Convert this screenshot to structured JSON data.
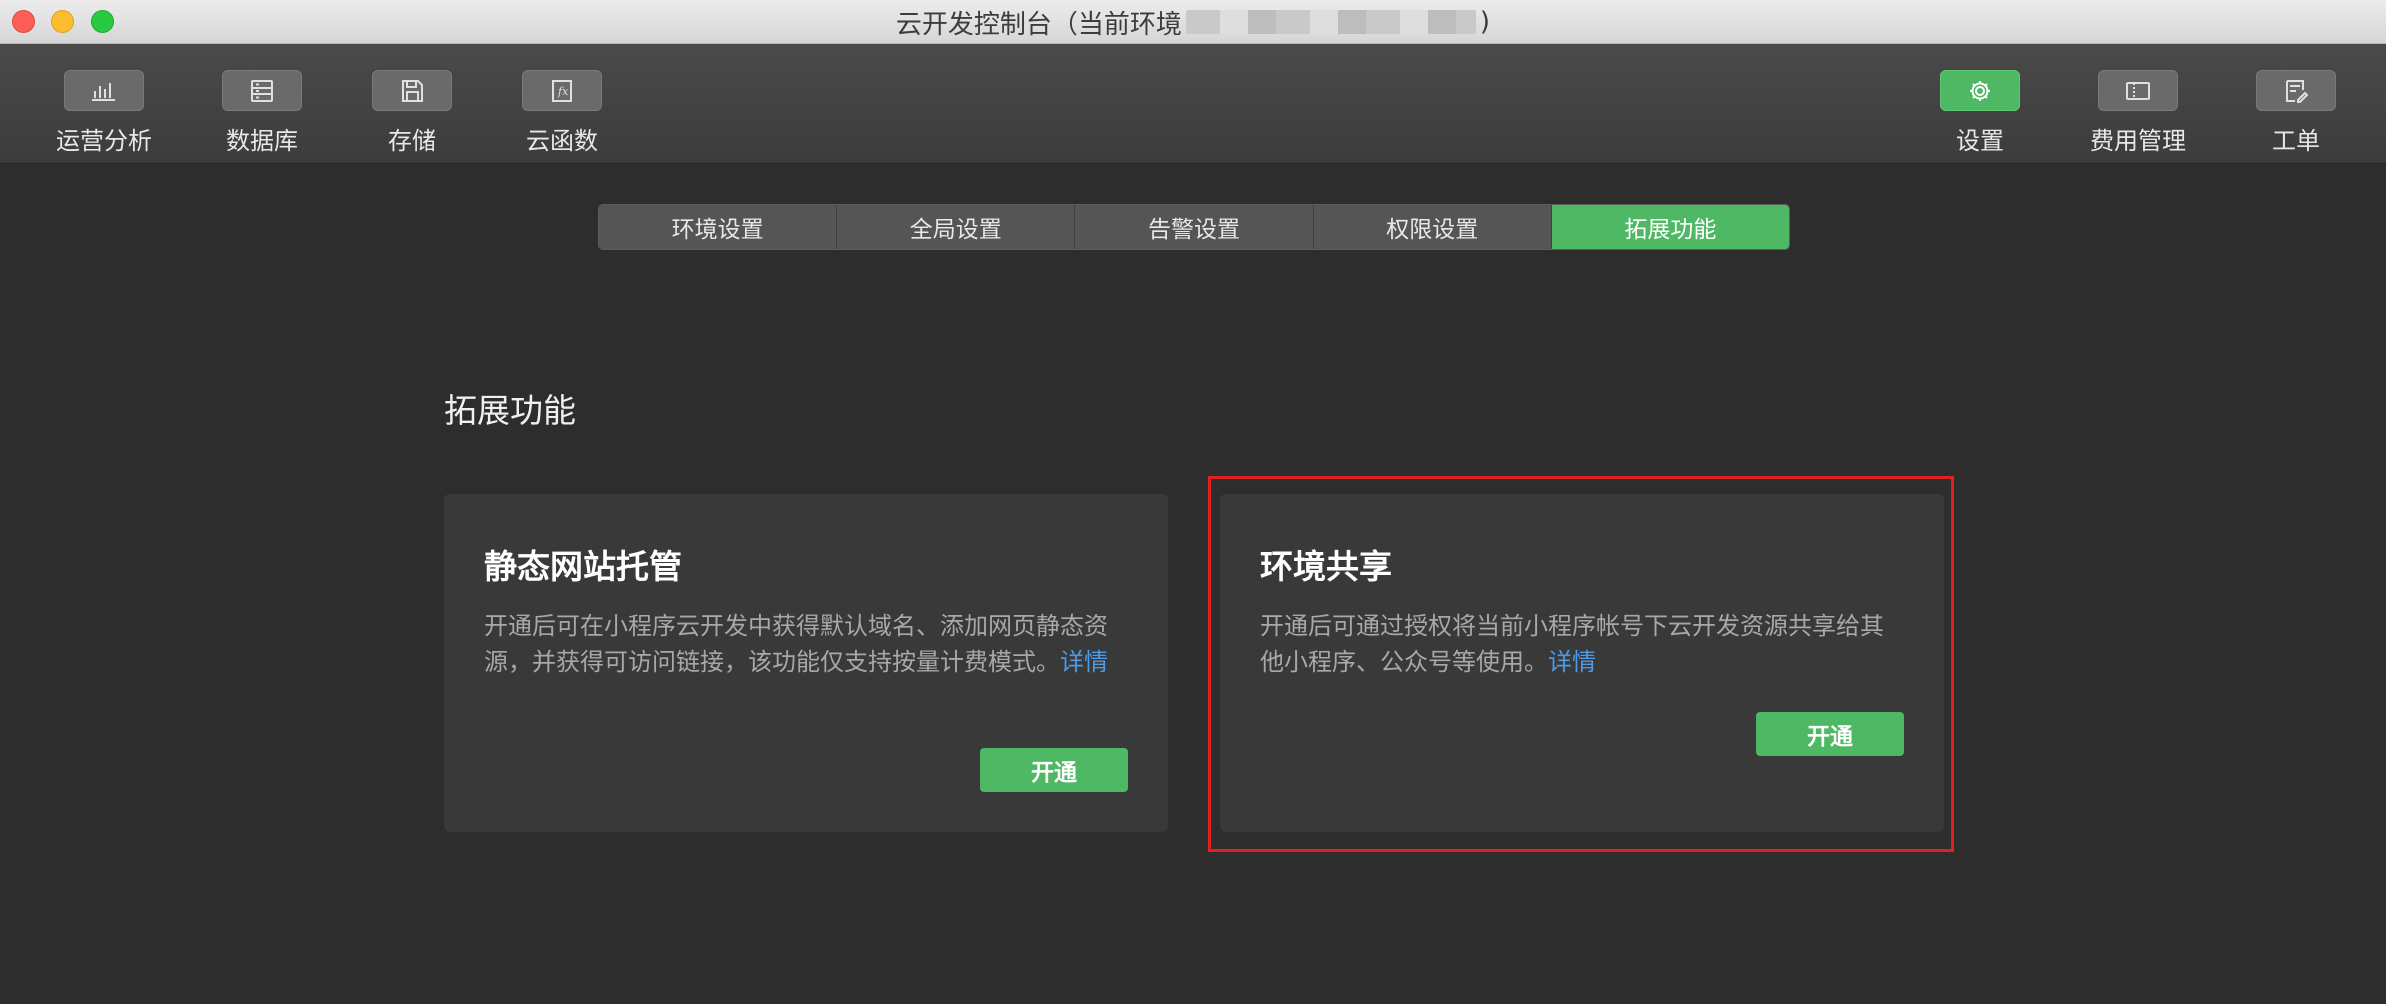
{
  "window": {
    "title_prefix": "云开发控制台（当前环境",
    "title_suffix": ")"
  },
  "toolbar": {
    "left": [
      {
        "label": "运营分析",
        "icon": "bar-chart-icon"
      },
      {
        "label": "数据库",
        "icon": "database-icon"
      },
      {
        "label": "存储",
        "icon": "save-disk-icon"
      },
      {
        "label": "云函数",
        "icon": "function-icon"
      }
    ],
    "right": [
      {
        "label": "设置",
        "icon": "gear-icon",
        "active": true
      },
      {
        "label": "费用管理",
        "icon": "ticket-icon"
      },
      {
        "label": "工单",
        "icon": "ticket-edit-icon"
      }
    ]
  },
  "tabs": [
    {
      "label": "环境设置"
    },
    {
      "label": "全局设置"
    },
    {
      "label": "告警设置"
    },
    {
      "label": "权限设置"
    },
    {
      "label": "拓展功能",
      "active": true
    }
  ],
  "section": {
    "title": "拓展功能"
  },
  "cards": [
    {
      "title": "静态网站托管",
      "desc": "开通后可在小程序云开发中获得默认域名、添加网页静态资源，并获得可访问链接，该功能仅支持按量计费模式。",
      "link": "详情",
      "button": "开通"
    },
    {
      "title": "环境共享",
      "desc": "开通后可通过授权将当前小程序帐号下云开发资源共享给其他小程序、公众号等使用。",
      "link": "详情",
      "button": "开通"
    }
  ],
  "colors": {
    "accent": "#4fb864",
    "link": "#4b9be8",
    "highlight": "#e02020",
    "background": "#2d2d2d"
  }
}
